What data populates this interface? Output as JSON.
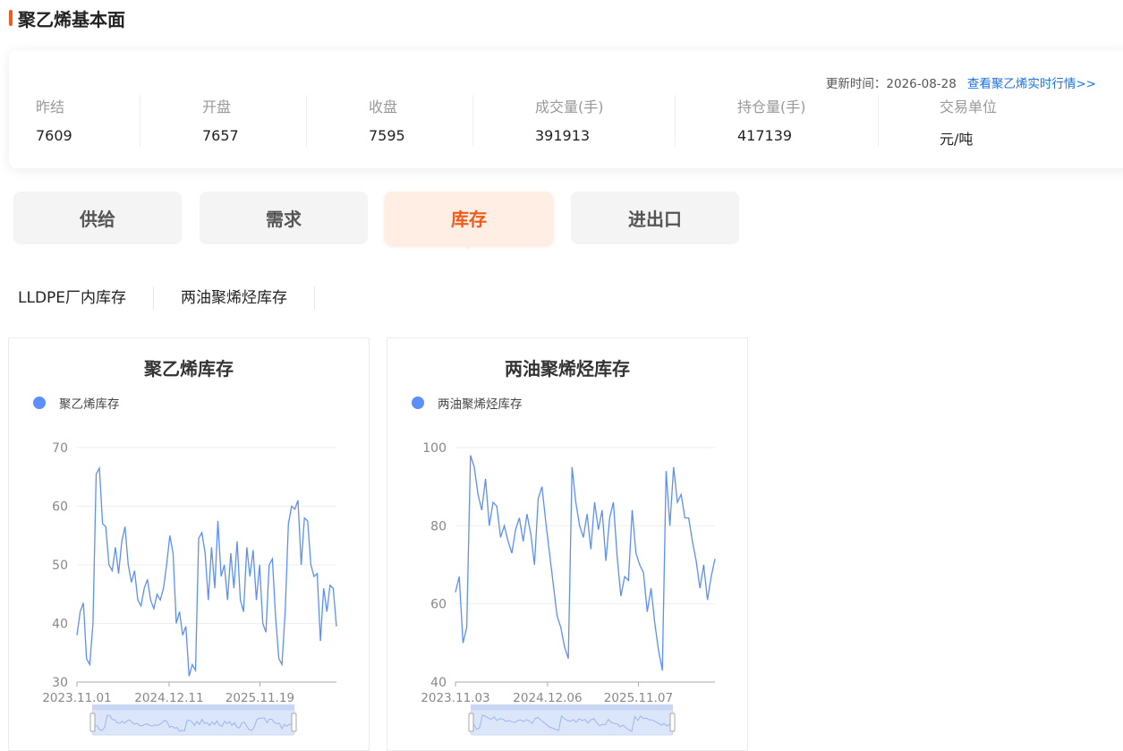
{
  "page": {
    "title": "聚乙烯基本面"
  },
  "update": {
    "label": "更新时间：2026-08-28",
    "link": "查看聚乙烯实时行情>>"
  },
  "stats": [
    {
      "label": "昨结",
      "value": "7609"
    },
    {
      "label": "开盘",
      "value": "7657"
    },
    {
      "label": "收盘",
      "value": "7595"
    },
    {
      "label": "成交量(手)",
      "value": "391913"
    },
    {
      "label": "持仓量(手)",
      "value": "417139"
    },
    {
      "label": "交易单位",
      "value": "元/吨"
    }
  ],
  "tabs": [
    {
      "label": "供给",
      "active": false
    },
    {
      "label": "需求",
      "active": false
    },
    {
      "label": "库存",
      "active": true
    },
    {
      "label": "进出口",
      "active": false
    }
  ],
  "subtabs": [
    "LLDPE厂内库存",
    "两油聚烯烃库存"
  ],
  "colors": {
    "accent": "#f05a1a",
    "series": "#5b8ff9",
    "link": "#1b73e8"
  },
  "chart_data": [
    {
      "type": "line",
      "title": "聚乙烯库存",
      "series": [
        {
          "name": "聚乙烯库存",
          "values": [
            38,
            42,
            43.5,
            34,
            33,
            40,
            65.5,
            66.5,
            57,
            56.5,
            50,
            49,
            53,
            48.5,
            54,
            56.5,
            50,
            47,
            49,
            44,
            43,
            46,
            47.5,
            44,
            42.5,
            45,
            44,
            46,
            50,
            55,
            52,
            40,
            42,
            38,
            39.5,
            31,
            33,
            32,
            54.5,
            55.5,
            52,
            44,
            53,
            46,
            57.5,
            48,
            50,
            44,
            52,
            46,
            54,
            44,
            42,
            53,
            48,
            52.5,
            44,
            50,
            40,
            38.5,
            50,
            51,
            41,
            34,
            33,
            42,
            57,
            60,
            59.5,
            61,
            50,
            58,
            57.5,
            50,
            48,
            48.5,
            37,
            46,
            42,
            46.5,
            46,
            39.5
          ]
        }
      ],
      "x_ticks": [
        "2023.11.01",
        "2024.12.11",
        "2025.11.19"
      ],
      "ylim": [
        30,
        70
      ],
      "y_ticks": [
        30,
        40,
        50,
        60,
        70
      ]
    },
    {
      "type": "line",
      "title": "两油聚烯烃库存",
      "series": [
        {
          "name": "两油聚烯烃库存",
          "values": [
            63,
            67,
            50,
            54,
            98,
            95,
            88,
            84,
            92,
            80,
            86,
            85,
            77,
            80,
            76,
            73,
            79,
            82,
            76,
            83,
            78,
            70,
            87,
            90,
            81,
            73,
            65,
            57,
            54,
            49,
            46,
            95,
            86,
            80,
            77,
            83,
            74,
            86,
            79,
            84,
            71,
            82,
            86,
            72,
            62,
            67,
            66,
            84,
            73,
            70,
            68,
            58,
            64,
            55,
            48,
            43,
            94,
            80,
            95,
            86,
            88,
            82,
            82,
            76,
            71,
            64,
            70,
            61,
            67,
            71.5
          ]
        }
      ],
      "x_ticks": [
        "2023.11.03",
        "2024.12.06",
        "2025.11.07"
      ],
      "ylim": [
        40,
        100
      ],
      "y_ticks": [
        40,
        60,
        80,
        100
      ]
    }
  ]
}
